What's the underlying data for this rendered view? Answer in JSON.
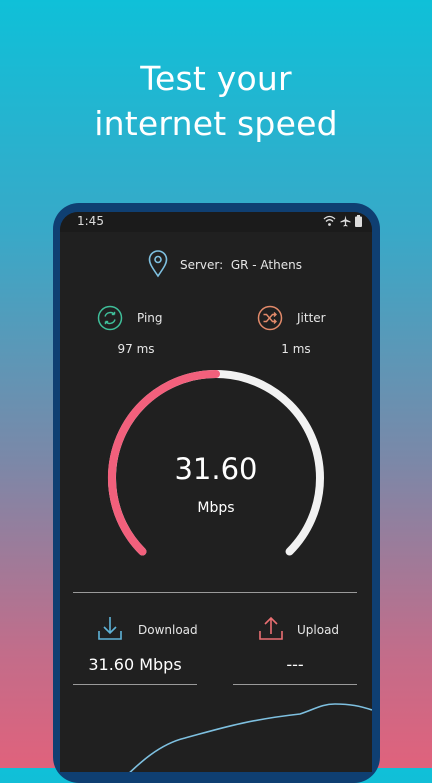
{
  "promo": {
    "line1": "Test your",
    "line2": "internet speed"
  },
  "status_bar": {
    "time": "1:45"
  },
  "server": {
    "label": "Server:",
    "name": "GR - Athens"
  },
  "ping": {
    "label": "Ping",
    "value": "97 ms"
  },
  "jitter": {
    "label": "Jitter",
    "value": "1 ms"
  },
  "gauge": {
    "value": "31.60",
    "unit": "Mbps",
    "progress": 0.5
  },
  "download": {
    "label": "Download",
    "value": "31.60 Mbps"
  },
  "upload": {
    "label": "Upload",
    "value": "---"
  },
  "colors": {
    "accent": "#f2607c",
    "gauge_track": "#f2f2f2",
    "ping_icon": "#3fbf9a",
    "jitter_icon": "#e38a6a",
    "download_icon": "#5fb3d8",
    "upload_icon": "#ea6f72",
    "graph_line": "#7ec0e0"
  },
  "icons": [
    "location-pin-icon",
    "ping-icon",
    "jitter-icon",
    "download-icon",
    "upload-icon",
    "wifi-icon",
    "airplane-icon",
    "battery-icon"
  ]
}
